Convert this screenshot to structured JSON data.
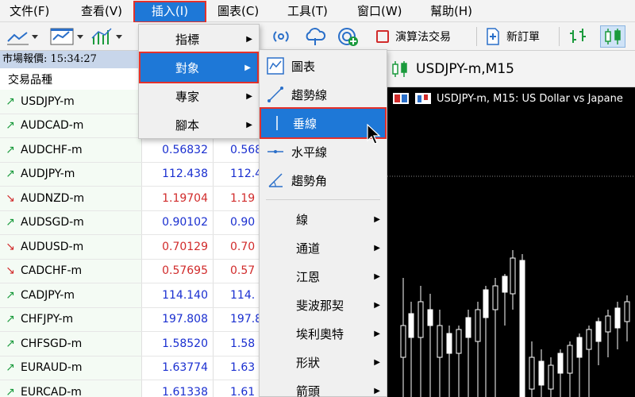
{
  "menubar": {
    "items": [
      {
        "label": "文件(F)"
      },
      {
        "label": "查看(V)"
      },
      {
        "label": "插入(I)"
      },
      {
        "label": "圖表(C)"
      },
      {
        "label": "工具(T)"
      },
      {
        "label": "窗口(W)"
      },
      {
        "label": "幫助(H)"
      }
    ]
  },
  "toolbar": {
    "algo_trading": "演算法交易",
    "new_order": "新訂單"
  },
  "market_watch": {
    "header": "市場報價: 15:34:27",
    "col_symbol": "交易品種",
    "rows": [
      {
        "symbol": "USDJPY-m",
        "bid": "",
        "ask": "",
        "dir": "up",
        "color": "blue"
      },
      {
        "symbol": "AUDCAD-m",
        "bid": "",
        "ask": "",
        "dir": "up",
        "color": "blue"
      },
      {
        "symbol": "AUDCHF-m",
        "bid": "0.56832",
        "ask": "0.568",
        "dir": "up",
        "color": "blue"
      },
      {
        "symbol": "AUDJPY-m",
        "bid": "112.438",
        "ask": "112.4",
        "dir": "up",
        "color": "blue"
      },
      {
        "symbol": "AUDNZD-m",
        "bid": "1.19704",
        "ask": "1.19",
        "dir": "down",
        "color": "red"
      },
      {
        "symbol": "AUDSGD-m",
        "bid": "0.90102",
        "ask": "0.90",
        "dir": "up",
        "color": "blue"
      },
      {
        "symbol": "AUDUSD-m",
        "bid": "0.70129",
        "ask": "0.70",
        "dir": "down",
        "color": "red"
      },
      {
        "symbol": "CADCHF-m",
        "bid": "0.57695",
        "ask": "0.57",
        "dir": "down",
        "color": "red"
      },
      {
        "symbol": "CADJPY-m",
        "bid": "114.140",
        "ask": "114.",
        "dir": "up",
        "color": "blue"
      },
      {
        "symbol": "CHFJPY-m",
        "bid": "197.808",
        "ask": "197.8",
        "dir": "up",
        "color": "blue"
      },
      {
        "symbol": "CHFSGD-m",
        "bid": "1.58520",
        "ask": "1.58",
        "dir": "up",
        "color": "blue"
      },
      {
        "symbol": "EURAUD-m",
        "bid": "1.63774",
        "ask": "1.63",
        "dir": "up",
        "color": "blue"
      },
      {
        "symbol": "EURCAD-m",
        "bid": "1.61338",
        "ask": "1.61",
        "dir": "up",
        "color": "blue"
      }
    ]
  },
  "insert_menu": {
    "items": [
      {
        "label": "指標"
      },
      {
        "label": "對象"
      },
      {
        "label": "專家"
      },
      {
        "label": "腳本"
      }
    ]
  },
  "objects_menu": {
    "items": [
      {
        "label": "圖表"
      },
      {
        "label": "趨勢線"
      },
      {
        "label": "垂線"
      },
      {
        "label": "水平線"
      },
      {
        "label": "趨勢角"
      },
      {
        "label": "線"
      },
      {
        "label": "通道"
      },
      {
        "label": "江恩"
      },
      {
        "label": "斐波那契"
      },
      {
        "label": "埃利奧特"
      },
      {
        "label": "形狀"
      },
      {
        "label": "箭頭"
      }
    ]
  },
  "chart": {
    "tab_title": "USDJPY-m,M15",
    "header": "USDJPY-m, M15:  US Dollar vs Japane"
  },
  "colors": {
    "accent": "#1e78d7",
    "highlight_border": "#e4312b",
    "bid_up": "#1a2fd0",
    "bid_down": "#d12b2b"
  }
}
